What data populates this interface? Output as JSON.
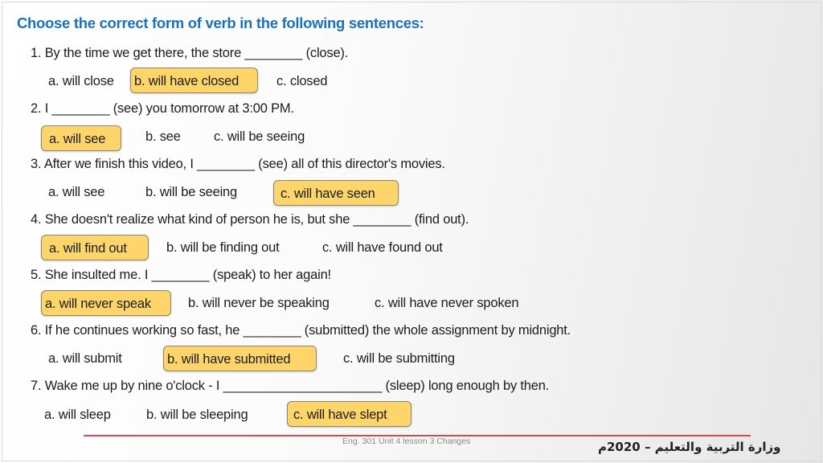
{
  "title": "Choose the correct form of verb in the following sentences:",
  "questions": [
    {
      "text": "1. By the time we get there, the store ________ (close).",
      "options": [
        "a. will close",
        "b. will have closed",
        "c. closed"
      ],
      "correct_index": 1
    },
    {
      "text": "2. I ________ (see) you tomorrow at 3:00 PM.",
      "options": [
        "a. will see",
        "b. see",
        "c. will be seeing"
      ],
      "correct_index": 0
    },
    {
      "text": "3. After we finish this video, I ________ (see) all of this director's movies.",
      "options": [
        "a. will see",
        "b.  will be seeing",
        "c. will have seen"
      ],
      "correct_index": 2
    },
    {
      "text": "4. She doesn't realize what kind of person he is, but she ________ (find out).",
      "options": [
        "a. will find out",
        "b. will be finding out",
        "c. will have found out"
      ],
      "correct_index": 0
    },
    {
      "text": "5. She insulted me. I ________ (speak) to her again!",
      "options": [
        "a.  will never speak",
        "b.  will never be speaking",
        "c.  will have never spoken"
      ],
      "correct_index": 0
    },
    {
      "text": "6. If he continues working so fast, he ________ (submitted) the whole assignment by midnight.",
      "options": [
        "a. will submit",
        "b. will have submitted",
        "c.  will be submitting"
      ],
      "correct_index": 1
    },
    {
      "text": "7. Wake me up by nine o'clock - I ______________________ (sleep) long enough by then.",
      "options": [
        "a. will sleep",
        "b. will be sleeping",
        "c. will have slept"
      ],
      "correct_index": 2
    }
  ],
  "colors": {
    "title": "#1a73b8",
    "highlight_fill": "#fdd56b",
    "highlight_border": "#8c8570",
    "footer_rule": "#e0474c"
  },
  "footer": {
    "course_note": "Eng. 301 Unit 4 lesson 3 Changes",
    "ministry": "وزارة التربية والتعليم – 2020م"
  }
}
